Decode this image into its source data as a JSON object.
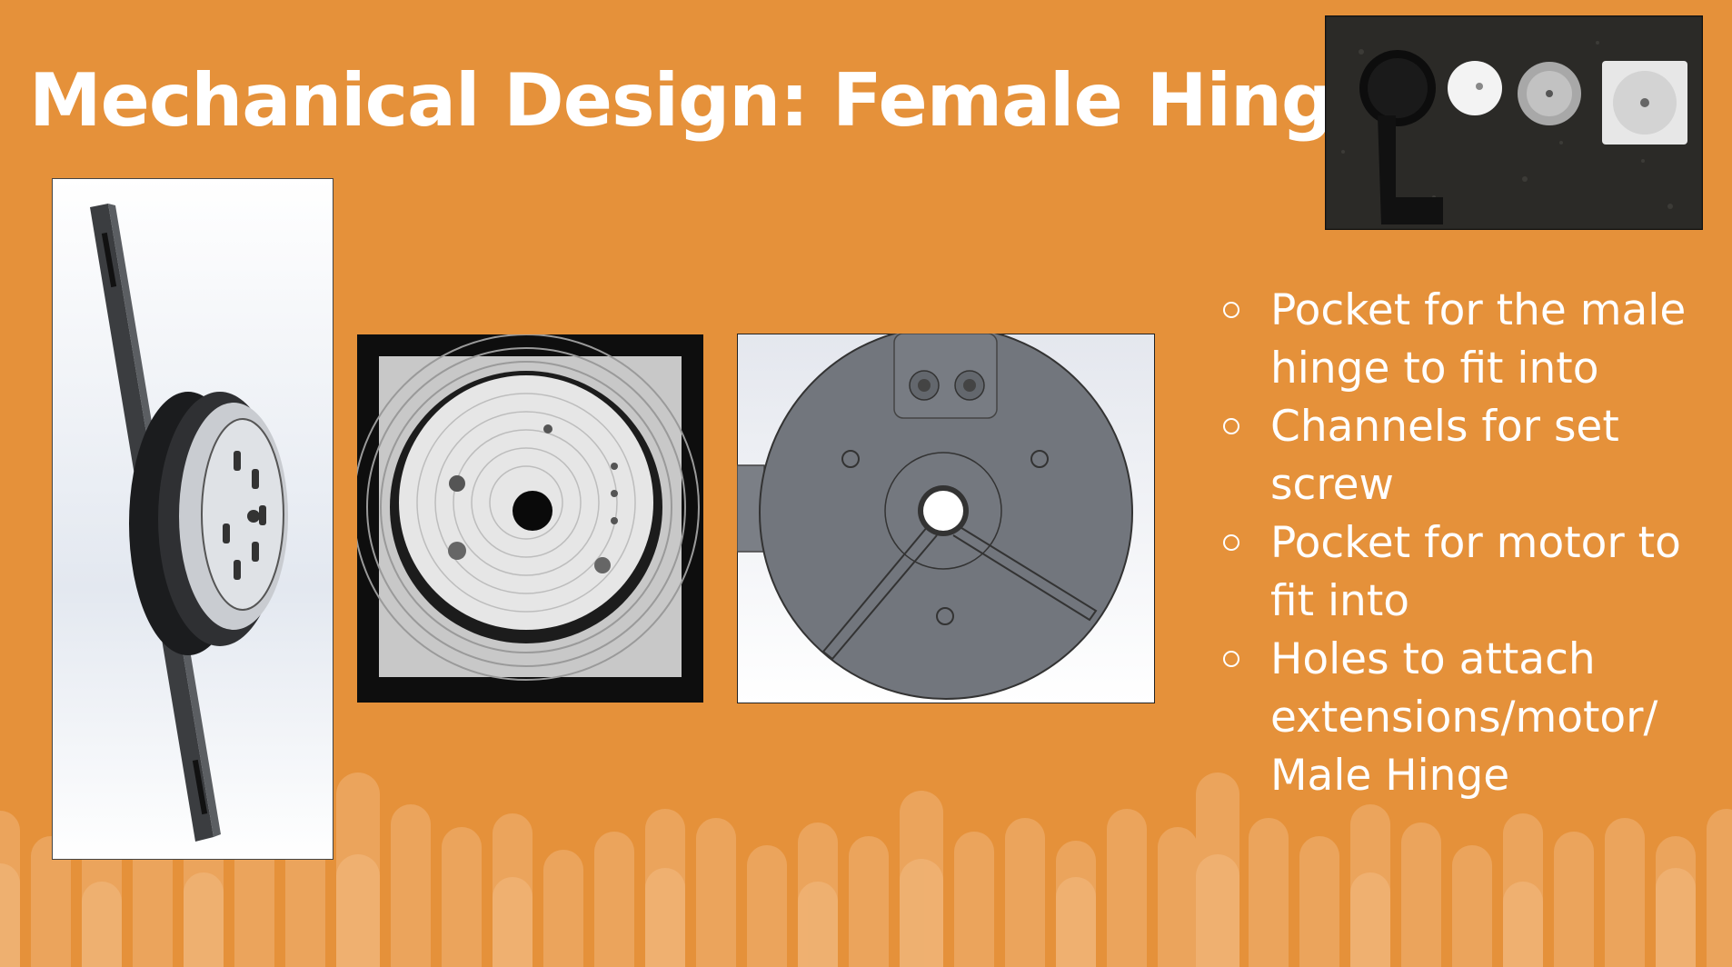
{
  "slide": {
    "title": "Mechanical Design: Female Hinge",
    "bullets": [
      "Pocket for the male hinge to fit into",
      "Channels for set screw",
      "Pocket for motor to fit into",
      "Holes to attach extensions/motor/ Male Hinge"
    ],
    "colors": {
      "background": "#E5913A",
      "bar_light": "#F1B478",
      "text": "#FFFFFF"
    },
    "images": {
      "photo": "photo of machined and printed hinge parts",
      "cad_isometric": "CAD isometric view of female hinge assembly",
      "machined_part": "photo of machined aluminum hinge pocket",
      "cad_top": "CAD top view of female hinge"
    }
  }
}
